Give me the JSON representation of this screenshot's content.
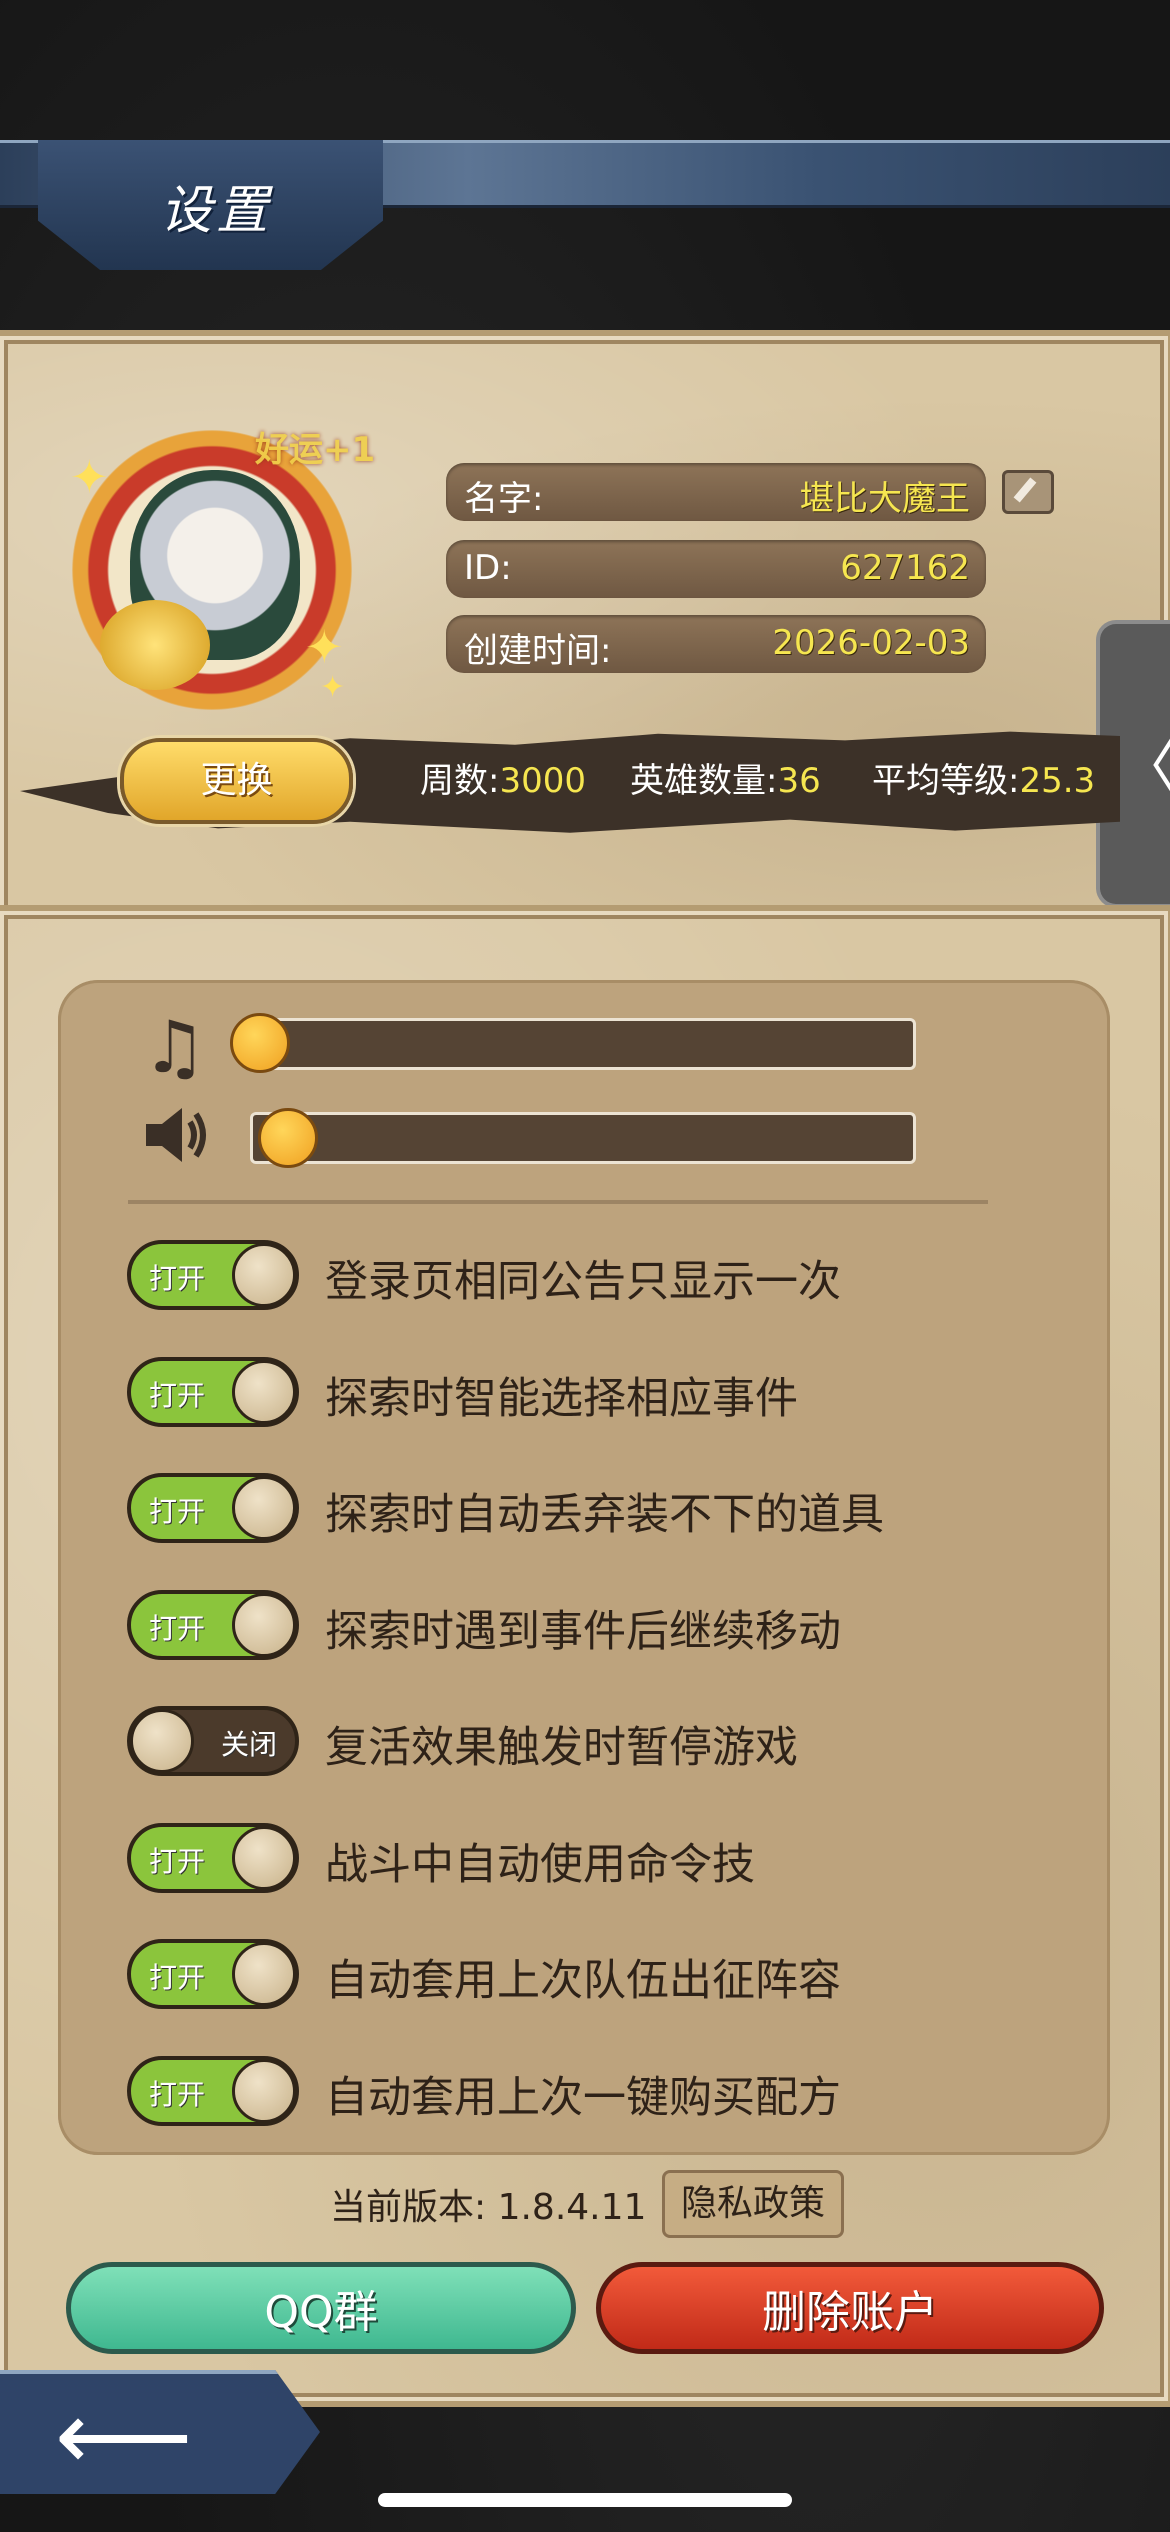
{
  "header": {
    "title": "设置"
  },
  "profile": {
    "avatar_badge": "好运+1",
    "name_label": "名字:",
    "name_value": "堪比大魔王",
    "id_label": "ID:",
    "id_value": "627162",
    "created_label": "创建时间:",
    "created_value": "2026-02-03",
    "change_button": "更换",
    "stats": {
      "weeks_label": "周数:",
      "weeks_value": "3000",
      "heroes_label": "英雄数量:",
      "heroes_value": "36",
      "avg_level_label": "平均等级:",
      "avg_level_value": "25.3"
    }
  },
  "side_tab": {
    "glyph": "〈"
  },
  "audio": {
    "music_icon": "music-note-icon",
    "sound_icon": "speaker-icon",
    "music_level": 0,
    "sound_level": 0
  },
  "toggles": [
    {
      "state_label": "打开",
      "on": true,
      "label": "登录页相同公告只显示一次"
    },
    {
      "state_label": "打开",
      "on": true,
      "label": "探索时智能选择相应事件"
    },
    {
      "state_label": "打开",
      "on": true,
      "label": "探索时自动丢弃装不下的道具"
    },
    {
      "state_label": "打开",
      "on": true,
      "label": "探索时遇到事件后继续移动"
    },
    {
      "state_label": "关闭",
      "on": false,
      "label": "复活效果触发时暂停游戏"
    },
    {
      "state_label": "打开",
      "on": true,
      "label": "战斗中自动使用命令技"
    },
    {
      "state_label": "打开",
      "on": true,
      "label": "自动套用上次队伍出征阵容"
    },
    {
      "state_label": "打开",
      "on": true,
      "label": "自动套用上次一键购买配方"
    }
  ],
  "footer": {
    "version_text": "当前版本: 1.8.4.11",
    "privacy_button": "隐私政策",
    "qq_button": "QQ群",
    "delete_button": "删除账户"
  },
  "colors": {
    "toggle_on": "#8bc53c",
    "toggle_off": "#4b3a2b",
    "value_yellow": "#f6e650"
  }
}
